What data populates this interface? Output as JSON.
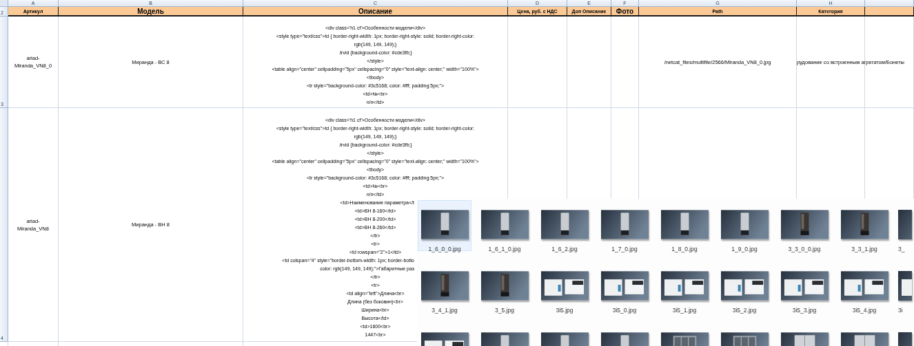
{
  "spreadsheet": {
    "column_letters": [
      "A",
      "B",
      "C",
      "D",
      "E",
      "F",
      "G",
      "H"
    ],
    "header_row": {
      "number": "2",
      "cells": [
        {
          "text": "Артикул",
          "large": false
        },
        {
          "text": "Модель",
          "large": true
        },
        {
          "text": "Описание",
          "large": true
        },
        {
          "text": "Цена, руб. с НДС",
          "large": false
        },
        {
          "text": "Доп Описание",
          "large": false
        },
        {
          "text": "Фото",
          "large": true
        },
        {
          "text": "Path",
          "large": false
        },
        {
          "text": "Категория",
          "large": false
        }
      ]
    },
    "rows": [
      {
        "number": "3",
        "article": "ariad-Miranda_VN8_0",
        "model": "Миранда - ВС 8",
        "description": [
          {
            "text": "<div class='h1 cf'>Особенности модели</div>",
            "cut": false
          },
          {
            "text": "<style type=\"text/css\">td { border-right-width: 1px; border-right-style: solid; border-right-color:",
            "cut": false
          },
          {
            "text": "rgb(149, 149, 149);}",
            "cut": false
          },
          {
            "text": ".trvid {background-color: #cde3fb;}",
            "cut": false
          },
          {
            "text": "</style>",
            "cut": false
          },
          {
            "text": "<table align=\"center\" cellpadding=\"5px\" cellspacing=\"0\" style=\"text-align: center;\" width=\"100%\">",
            "cut": false
          },
          {
            "text": "<tbody>",
            "cut": false
          },
          {
            "text": "<tr style=\"background-color: #3c5168; color: #fff; padding:5px;\">",
            "cut": false
          },
          {
            "text": "<td>№<br>",
            "cut": false
          },
          {
            "text": "n/n</td>",
            "cut": false
          }
        ],
        "path": "/netcat_files/multifile/2566/Miranda_VN8_0.jpg",
        "category": "рудование со встроенным агрегатом/Бонеты"
      },
      {
        "number": "4",
        "article": "ariad-Miranda_VN8",
        "model": "Миранда - ВН 8",
        "description": [
          {
            "text": "<div class='h1 cf'>Особенности модели</div>",
            "cut": false
          },
          {
            "text": "<style type=\"text/css\">td { border-right-width: 1px; border-right-style: solid; border-right-color:",
            "cut": false
          },
          {
            "text": "rgb(149, 149, 149);}",
            "cut": false
          },
          {
            "text": ".trvid {background-color: #cde3fb;}",
            "cut": false
          },
          {
            "text": "</style>",
            "cut": false
          },
          {
            "text": "<table align=\"center\" cellpadding=\"5px\" cellspacing=\"0\" style=\"text-align: center;\" width=\"100%\">",
            "cut": false
          },
          {
            "text": "<tbody>",
            "cut": false
          },
          {
            "text": "<tr style=\"background-color: #3c5168; color: #fff; padding:5px;\">",
            "cut": false
          },
          {
            "text": "<td>№<br>",
            "cut": false
          },
          {
            "text": "n/n</td>",
            "cut": false
          },
          {
            "text": "<td>Наименование параметра</t",
            "cut": true
          },
          {
            "text": "<td>ВН 8-160</td>",
            "cut": false
          },
          {
            "text": "<td>ВН 8-200</td>",
            "cut": false
          },
          {
            "text": "<td>ВН 8-260</td>",
            "cut": false
          },
          {
            "text": "</tr>",
            "cut": false
          },
          {
            "text": "<tr>",
            "cut": false
          },
          {
            "text": "<td rowspan=\"2\">1</td>",
            "cut": false
          },
          {
            "text": "<td colspan=\"4\" style=\"border-bottom-width: 1px; border-botto",
            "cut": true
          },
          {
            "text": "color: rgb(149, 149, 149);\">Габаритные раз",
            "cut": true
          },
          {
            "text": "</tr>",
            "cut": false
          },
          {
            "text": "<tr>",
            "cut": false
          },
          {
            "text": "<td align=\"left\">Длина<br>",
            "cut": false
          },
          {
            "text": "Длина (без боковин)<br>",
            "cut": false
          },
          {
            "text": "Ширина<br>",
            "cut": false
          },
          {
            "text": "Высота</td>",
            "cut": false
          },
          {
            "text": "<td>1600<br>",
            "cut": false
          },
          {
            "text": "1447<br>",
            "cut": false
          }
        ],
        "path": "",
        "category": ""
      }
    ]
  },
  "file_browser": {
    "items": [
      {
        "label": "1_6_0_0.jpg",
        "kind": "light-cabinet",
        "selected": true,
        "cut": false
      },
      {
        "label": "1_6_1_0.jpg",
        "kind": "light-cabinet",
        "selected": false,
        "cut": false
      },
      {
        "label": "1_6_2.jpg",
        "kind": "light-cabinet",
        "selected": false,
        "cut": false
      },
      {
        "label": "1_7_0.jpg",
        "kind": "light-cabinet",
        "selected": false,
        "cut": false
      },
      {
        "label": "1_8_0.jpg",
        "kind": "light-cabinet",
        "selected": false,
        "cut": false
      },
      {
        "label": "1_9_0.jpg",
        "kind": "light-cabinet",
        "selected": false,
        "cut": false
      },
      {
        "label": "3_3_0_0.jpg",
        "kind": "dark-cabinet",
        "selected": false,
        "cut": false
      },
      {
        "label": "3_3_1.jpg",
        "kind": "dark-cabinet",
        "selected": false,
        "cut": false
      },
      {
        "label": "3_",
        "kind": "dark-cabinet",
        "selected": false,
        "cut": true
      },
      {
        "label": "3_4_1.jpg",
        "kind": "dark-cabinet",
        "selected": false,
        "cut": false
      },
      {
        "label": "3_5.jpg",
        "kind": "dark-cabinet",
        "selected": false,
        "cut": false
      },
      {
        "label": "3i5.jpg",
        "kind": "split-unit",
        "selected": false,
        "cut": false
      },
      {
        "label": "3i5_0.jpg",
        "kind": "split-unit",
        "selected": false,
        "cut": false
      },
      {
        "label": "3i5_1.jpg",
        "kind": "split-unit",
        "selected": false,
        "cut": false
      },
      {
        "label": "3i5_2.jpg",
        "kind": "split-unit",
        "selected": false,
        "cut": false
      },
      {
        "label": "3i5_3.jpg",
        "kind": "split-unit",
        "selected": false,
        "cut": false
      },
      {
        "label": "3i5_4.jpg",
        "kind": "split-unit",
        "selected": false,
        "cut": false
      },
      {
        "label": "3i",
        "kind": "split-unit",
        "selected": false,
        "cut": true
      },
      {
        "kind": "split-unit",
        "selected": false,
        "cut": false
      },
      {
        "kind": "light-cabinet",
        "selected": false,
        "cut": false
      },
      {
        "kind": "light-cabinet",
        "selected": false,
        "cut": false
      },
      {
        "kind": "light-cabinet",
        "selected": false,
        "cut": false
      },
      {
        "kind": "glass-cabinet",
        "selected": false,
        "cut": false
      },
      {
        "kind": "glass-cabinet",
        "selected": false,
        "cut": false
      },
      {
        "kind": "double-cabinet",
        "selected": false,
        "cut": false
      },
      {
        "kind": "double-cabinet",
        "selected": false,
        "cut": false
      },
      {
        "kind": "double-cabinet",
        "selected": false,
        "cut": true
      }
    ]
  }
}
